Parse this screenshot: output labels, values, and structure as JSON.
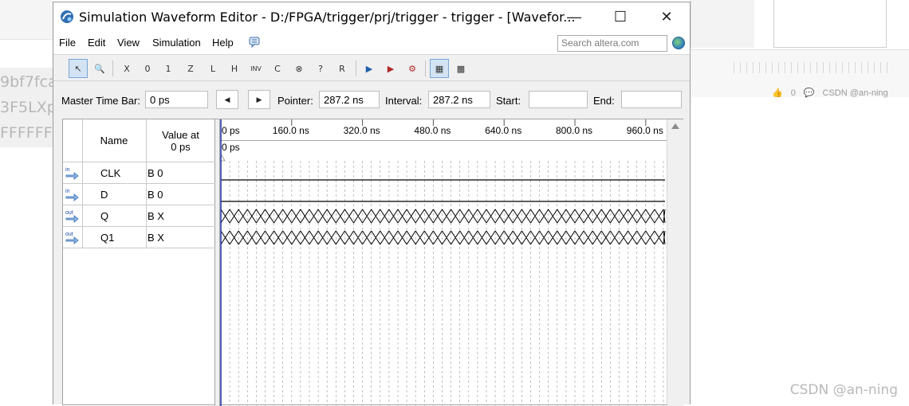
{
  "background": {
    "left_fragments": [
      "9bf7fca",
      "3F5LXp",
      "FFFFFF"
    ],
    "right_meta": {
      "like_count": "0",
      "author": "CSDN @an-ning"
    },
    "watermark": "CSDN @an-ning"
  },
  "window": {
    "title": "Simulation Waveform Editor - D:/FPGA/trigger/prj/trigger - trigger - [Wavefor...",
    "controls": {
      "minimize": "—",
      "maximize": "☐",
      "close": "✕"
    }
  },
  "menu": {
    "items": [
      "File",
      "Edit",
      "View",
      "Simulation",
      "Help"
    ],
    "search_placeholder": "Search altera.com"
  },
  "toolbar": {
    "buttons": [
      {
        "name": "selection-tool-icon",
        "glyph": "↖",
        "active": true
      },
      {
        "name": "zoom-tool-icon",
        "glyph": "🔍",
        "active": false
      },
      {
        "name": "force-unknown-icon",
        "glyph": "X",
        "active": false
      },
      {
        "name": "force-low-icon",
        "glyph": "0",
        "active": false
      },
      {
        "name": "force-high-icon",
        "glyph": "1",
        "active": false
      },
      {
        "name": "force-high-impedance-icon",
        "glyph": "Z",
        "active": false
      },
      {
        "name": "force-weak-low-icon",
        "glyph": "L",
        "active": false
      },
      {
        "name": "force-weak-high-icon",
        "glyph": "H",
        "active": false
      },
      {
        "name": "invert-icon",
        "glyph": "INV",
        "active": false
      },
      {
        "name": "count-value-icon",
        "glyph": "C",
        "active": false
      },
      {
        "name": "overwrite-clock-icon",
        "glyph": "⊗",
        "active": false
      },
      {
        "name": "random-values-icon",
        "glyph": "?",
        "active": false
      },
      {
        "name": "arbitrary-value-icon",
        "glyph": "R",
        "active": false
      },
      {
        "name": "run-functional-simulation-icon",
        "glyph": "▶",
        "active": false
      },
      {
        "name": "run-timing-simulation-icon",
        "glyph": "▶",
        "active": false
      },
      {
        "name": "generate-netlist-icon",
        "glyph": "⚙",
        "active": false
      },
      {
        "name": "snap-to-grid-icon",
        "glyph": "▦",
        "active": true
      },
      {
        "name": "grid-settings-icon",
        "glyph": "▩",
        "active": false
      }
    ]
  },
  "timebar": {
    "master_label": "Master Time Bar:",
    "master_value": "0 ps",
    "pointer_label": "Pointer:",
    "pointer_value": "287.2 ns",
    "interval_label": "Interval:",
    "interval_value": "287.2 ns",
    "start_label": "Start:",
    "start_value": "",
    "end_label": "End:",
    "end_value": ""
  },
  "table": {
    "name_header": "Name",
    "value_header_line1": "Value at",
    "value_header_line2": "0 ps",
    "rows": [
      {
        "dir": "in",
        "name": "CLK",
        "value": "B 0"
      },
      {
        "dir": "in",
        "name": "D",
        "value": "B 0"
      },
      {
        "dir": "out",
        "name": "Q",
        "value": "B X"
      },
      {
        "dir": "out",
        "name": "Q1",
        "value": "B X"
      }
    ]
  },
  "waveform": {
    "time_ticks": [
      "0 ps",
      "160.0 ns",
      "320.0 ns",
      "480.0 ns",
      "640.0 ns",
      "800.0 ns",
      "960.0 ns"
    ],
    "cursor_label": "0 ps",
    "signals": [
      {
        "name": "CLK",
        "level": "low"
      },
      {
        "name": "D",
        "level": "low"
      },
      {
        "name": "Q",
        "level": "unknown"
      },
      {
        "name": "Q1",
        "level": "unknown"
      }
    ]
  },
  "colors": {
    "cursor": "#1c2ea8",
    "waveform": "#000000",
    "grid": "#9a9a9a",
    "active_button": "#d3e3f4"
  }
}
